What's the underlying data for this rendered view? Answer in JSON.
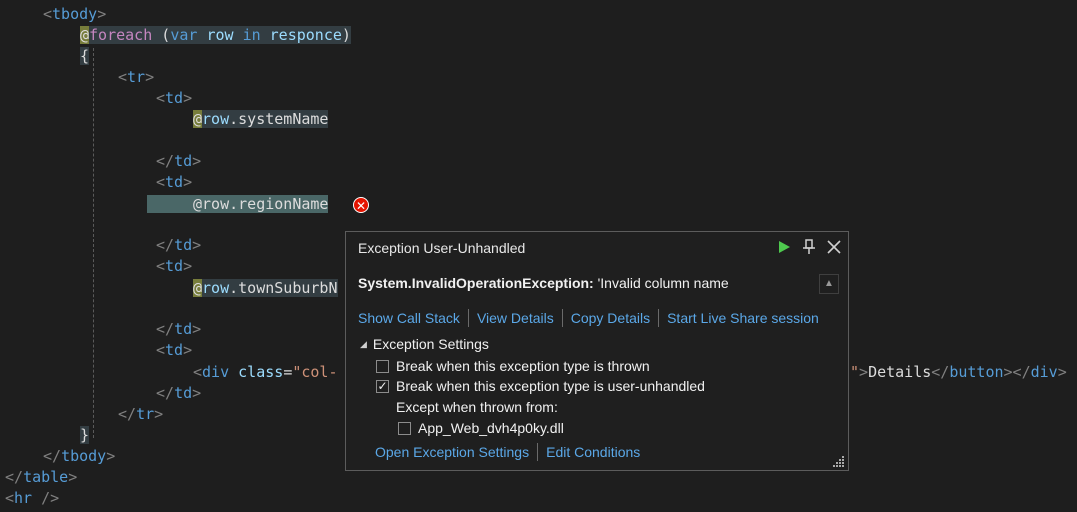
{
  "code": {
    "tbody_open": "tbody",
    "foreach_at": "@",
    "foreach_kw": "foreach",
    "paren_open": " (",
    "var_kw": "var",
    "row_var": "row",
    "in_kw": "in",
    "responce_var": "responce",
    "paren_close": ")",
    "brace_open": "{",
    "tr": "tr",
    "td": "td",
    "row_system": "row",
    "system_prop": ".systemName",
    "row_region": "@row.regionName",
    "row_town": "row",
    "town_prop": ".townSuburbN",
    "div_tag": "div",
    "class_attr": "class",
    "class_val": "\"col-",
    "details_tail_quote": "\"",
    "details_text": "Details",
    "button_tag": "button",
    "brace_close": "}",
    "table_tag": "table",
    "hr_tag": "hr"
  },
  "popup": {
    "title": "Exception User-Unhandled",
    "exception_type": "System.InvalidOperationException:",
    "exception_message": " 'Invalid column name",
    "links": {
      "call_stack": "Show Call Stack",
      "view_details": "View Details",
      "copy_details": "Copy Details",
      "live_share": "Start Live Share session"
    },
    "settings_header": "Exception Settings",
    "break_thrown": "Break when this exception type is thrown",
    "break_thrown_checked": false,
    "break_unhandled": "Break when this exception type is user-unhandled",
    "break_unhandled_checked": true,
    "except_label": "Except when thrown from:",
    "module": "App_Web_dvh4p0ky.dll",
    "module_checked": false,
    "open_settings": "Open Exception Settings",
    "edit_conditions": "Edit Conditions"
  },
  "icons": {
    "error": "error-icon",
    "play": "continue-icon",
    "pin": "pin-icon",
    "close": "close-icon"
  },
  "colors": {
    "error_red": "#e51400",
    "continue_green": "#4ec94e",
    "link_blue": "#5ba8e8"
  }
}
